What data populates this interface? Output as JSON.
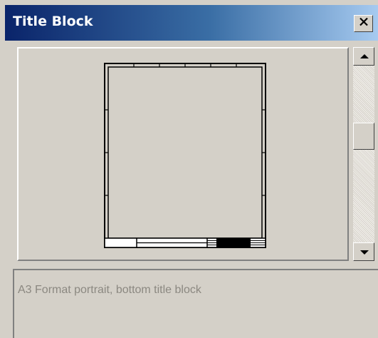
{
  "window": {
    "title": "Title Block",
    "close_label": "✕"
  },
  "preview": {
    "sheet_icon": "a3-portrait-drawing-sheet-icon"
  },
  "scrollbar": {
    "up_icon": "arrow-up-icon",
    "down_icon": "arrow-down-icon",
    "position": 0.38
  },
  "description": {
    "text": "A3 Format portrait, bottom title block"
  },
  "colors": {
    "titlebar_start": "#0a246a",
    "titlebar_end": "#a6caf0",
    "face": "#d4d0c8",
    "disabled_text": "#8b8881"
  }
}
